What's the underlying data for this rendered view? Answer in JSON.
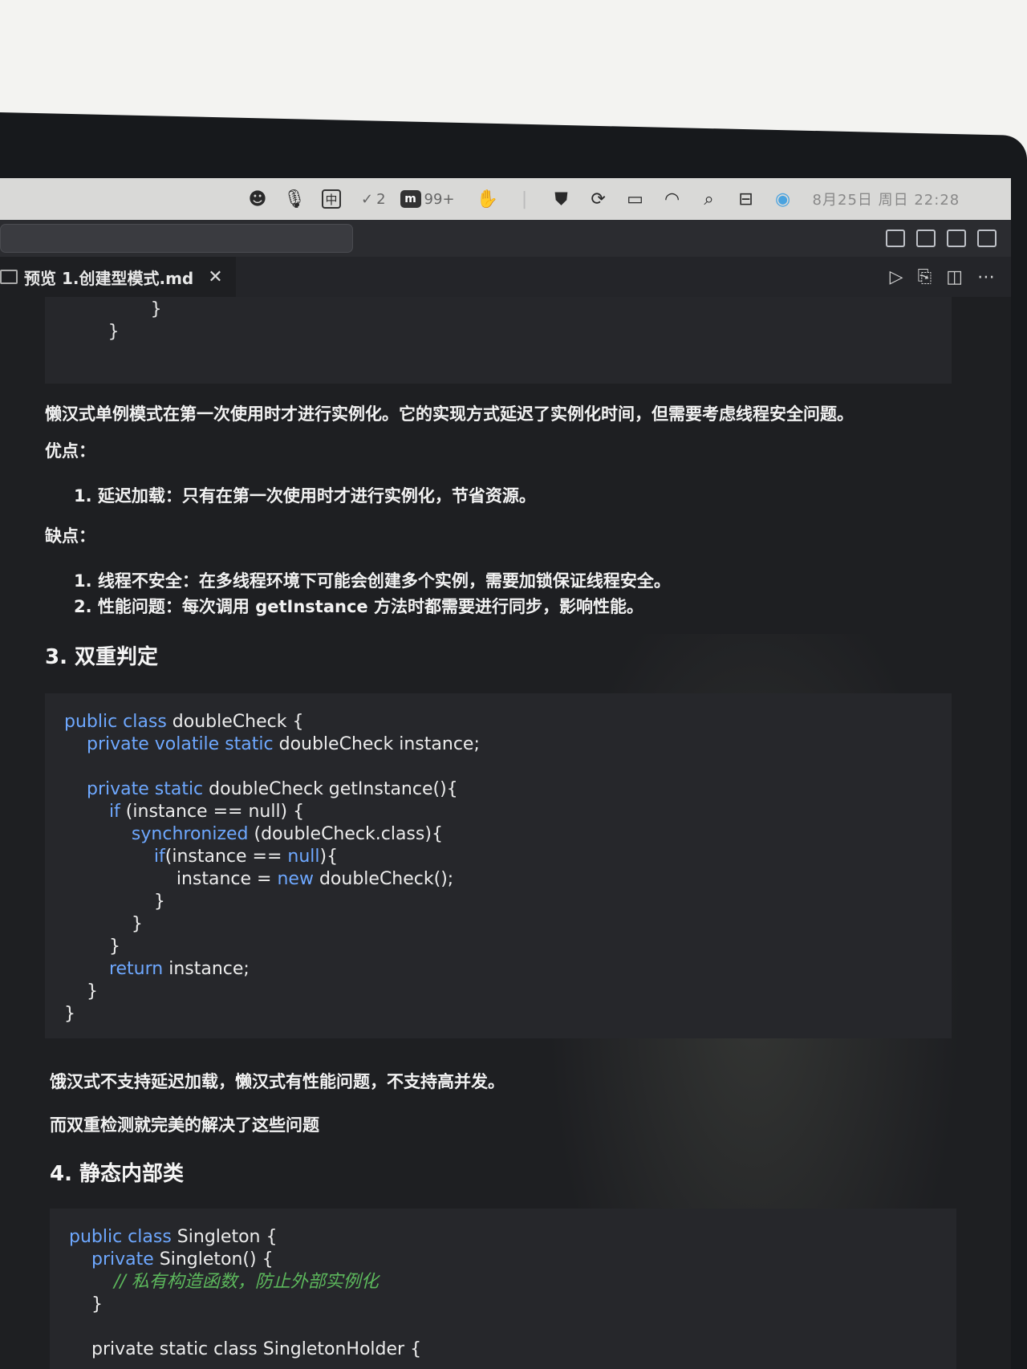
{
  "menubar": {
    "ime_label": "中",
    "todo_count": "2",
    "app_badge": "99+",
    "datetime": "8月25日 周日 22:28"
  },
  "tab": {
    "title": "预览 1.创建型模式.md",
    "close": "✕"
  },
  "content": {
    "code_tail": "        }\n    }",
    "lazy_intro": "懒汉式单例模式在第一次使用时才进行实例化。它的实现方式延迟了实例化时间，但需要考虑线程安全问题。",
    "pros_label": "优点：",
    "pros": [
      "1. 延迟加载：只有在第一次使用时才进行实例化，节省资源。"
    ],
    "cons_label": "缺点：",
    "cons": [
      "1. 线程不安全：在多线程环境下可能会创建多个实例，需要加锁保证线程安全。",
      "2. 性能问题：每次调用 getInstance 方法时都需要进行同步，影响性能。"
    ],
    "section3_title": "3. 双重判定",
    "section3_code": {
      "line1_kw": "public class",
      "line1_rest": " doubleCheck {",
      "line2_kw": "    private volatile static",
      "line2_rest": " doubleCheck instance;",
      "line4_kw": "    private static",
      "line4_rest": " doubleCheck getInstance(){",
      "line5_kw": "        if",
      "line5_rest": " (instance == null) {",
      "line6_kw": "            synchronized",
      "line6_rest": " (doubleCheck.class){",
      "line7_kw": "                if",
      "line7_rest": "(instance == ",
      "line7_kw2": "null",
      "line7_end": "){",
      "line8_pre": "                    instance = ",
      "line8_kw": "new",
      "line8_rest": " doubleCheck();",
      "line9": "                }",
      "line10": "            }",
      "line11": "        }",
      "line12_kw": "        return",
      "line12_rest": " instance;",
      "line13": "    }",
      "line14": "}"
    },
    "summary1": "饿汉式不支持延迟加载，懒汉式有性能问题，不支持高并发。",
    "summary2": "而双重检测就完美的解决了这些问题",
    "section4_title": "4. 静态内部类",
    "section4_code": {
      "line1_kw": "public class",
      "line1_rest": " Singleton {",
      "line2_kw": "    private",
      "line2_rest": " Singleton() {",
      "line3": "        // 私有构造函数，防止外部实例化",
      "line4": "    }",
      "line6": "    private static class SingletonHolder {"
    }
  }
}
